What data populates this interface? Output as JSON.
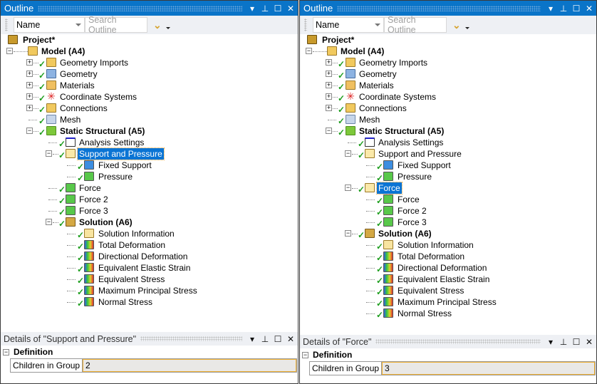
{
  "panels": [
    {
      "title": "Outline",
      "toolbar": {
        "name_select": "Name",
        "search_placeholder": "Search Outline"
      },
      "tree": [
        {
          "level": 0,
          "label": "Project*",
          "icon": "project",
          "bold": true
        },
        {
          "level": 1,
          "label": "Model (A4)",
          "icon": "folder",
          "bold": true,
          "exp": "-"
        },
        {
          "level": 2,
          "label": "Geometry Imports",
          "icon": "folder",
          "exp": "+",
          "check": true
        },
        {
          "level": 2,
          "label": "Geometry",
          "icon": "geom",
          "exp": "+",
          "check": true
        },
        {
          "level": 2,
          "label": "Materials",
          "icon": "mat",
          "exp": "+",
          "check": true
        },
        {
          "level": 2,
          "label": "Coordinate Systems",
          "icon": "coord",
          "exp": "+",
          "check": true
        },
        {
          "level": 2,
          "label": "Connections",
          "icon": "folder",
          "exp": "+",
          "check": true
        },
        {
          "level": 2,
          "label": "Mesh",
          "icon": "mesh",
          "check": true
        },
        {
          "level": 2,
          "label": "Static Structural (A5)",
          "icon": "static",
          "bold": true,
          "exp": "-",
          "check": true
        },
        {
          "level": 3,
          "label": "Analysis Settings",
          "icon": "analysis",
          "check": true
        },
        {
          "level": 3,
          "label": "Support and Pressure",
          "icon": "folderp",
          "exp": "-",
          "check": true,
          "selected": true
        },
        {
          "level": 4,
          "label": "Fixed Support",
          "icon": "support",
          "check": true
        },
        {
          "level": 4,
          "label": "Pressure",
          "icon": "load",
          "check": true
        },
        {
          "level": 3,
          "label": "Force",
          "icon": "load",
          "check": true
        },
        {
          "level": 3,
          "label": "Force 2",
          "icon": "load",
          "check": true
        },
        {
          "level": 3,
          "label": "Force 3",
          "icon": "load",
          "check": true
        },
        {
          "level": 3,
          "label": "Solution (A6)",
          "icon": "solution",
          "bold": true,
          "exp": "-",
          "check": true
        },
        {
          "level": 4,
          "label": "Solution Information",
          "icon": "info",
          "check": true
        },
        {
          "level": 4,
          "label": "Total Deformation",
          "icon": "result",
          "check": true
        },
        {
          "level": 4,
          "label": "Directional Deformation",
          "icon": "result",
          "check": true
        },
        {
          "level": 4,
          "label": "Equivalent Elastic Strain",
          "icon": "result",
          "check": true
        },
        {
          "level": 4,
          "label": "Equivalent Stress",
          "icon": "result",
          "check": true
        },
        {
          "level": 4,
          "label": "Maximum Principal Stress",
          "icon": "result",
          "check": true
        },
        {
          "level": 4,
          "label": "Normal Stress",
          "icon": "result",
          "check": true
        }
      ],
      "details": {
        "title": "Details of \"Support and Pressure\"",
        "section": "Definition",
        "prop_name": "Children in Group",
        "prop_value": "2"
      }
    },
    {
      "title": "Outline",
      "toolbar": {
        "name_select": "Name",
        "search_placeholder": "Search Outline"
      },
      "tree": [
        {
          "level": 0,
          "label": "Project*",
          "icon": "project",
          "bold": true
        },
        {
          "level": 1,
          "label": "Model (A4)",
          "icon": "folder",
          "bold": true,
          "exp": "-"
        },
        {
          "level": 2,
          "label": "Geometry Imports",
          "icon": "folder",
          "exp": "+",
          "check": true
        },
        {
          "level": 2,
          "label": "Geometry",
          "icon": "geom",
          "exp": "+",
          "check": true
        },
        {
          "level": 2,
          "label": "Materials",
          "icon": "mat",
          "exp": "+",
          "check": true
        },
        {
          "level": 2,
          "label": "Coordinate Systems",
          "icon": "coord",
          "exp": "+",
          "check": true
        },
        {
          "level": 2,
          "label": "Connections",
          "icon": "folder",
          "exp": "+",
          "check": true
        },
        {
          "level": 2,
          "label": "Mesh",
          "icon": "mesh",
          "check": true
        },
        {
          "level": 2,
          "label": "Static Structural (A5)",
          "icon": "static",
          "bold": true,
          "exp": "-",
          "check": true
        },
        {
          "level": 3,
          "label": "Analysis Settings",
          "icon": "analysis",
          "check": true
        },
        {
          "level": 3,
          "label": "Support and Pressure",
          "icon": "folderp",
          "exp": "-",
          "check": true
        },
        {
          "level": 4,
          "label": "Fixed Support",
          "icon": "support",
          "check": true
        },
        {
          "level": 4,
          "label": "Pressure",
          "icon": "load",
          "check": true
        },
        {
          "level": 3,
          "label": "Force",
          "icon": "folderp",
          "exp": "-",
          "check": true,
          "selected": true
        },
        {
          "level": 4,
          "label": "Force",
          "icon": "load",
          "check": true
        },
        {
          "level": 4,
          "label": "Force 2",
          "icon": "load",
          "check": true
        },
        {
          "level": 4,
          "label": "Force 3",
          "icon": "load",
          "check": true
        },
        {
          "level": 3,
          "label": "Solution (A6)",
          "icon": "solution",
          "bold": true,
          "exp": "-",
          "check": true
        },
        {
          "level": 4,
          "label": "Solution Information",
          "icon": "info",
          "check": true
        },
        {
          "level": 4,
          "label": "Total Deformation",
          "icon": "result",
          "check": true
        },
        {
          "level": 4,
          "label": "Directional Deformation",
          "icon": "result",
          "check": true
        },
        {
          "level": 4,
          "label": "Equivalent Elastic Strain",
          "icon": "result",
          "check": true
        },
        {
          "level": 4,
          "label": "Equivalent Stress",
          "icon": "result",
          "check": true
        },
        {
          "level": 4,
          "label": "Maximum Principal Stress",
          "icon": "result",
          "check": true
        },
        {
          "level": 4,
          "label": "Normal Stress",
          "icon": "result",
          "check": true
        }
      ],
      "details": {
        "title": "Details of \"Force\"",
        "section": "Definition",
        "prop_name": "Children in Group",
        "prop_value": "3"
      }
    }
  ],
  "colors": {
    "titlebar": "#0a74c8",
    "selection": "#0a74d4",
    "check": "#1e9e1e"
  }
}
